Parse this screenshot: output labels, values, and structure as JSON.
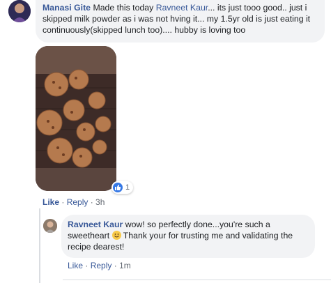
{
  "comment": {
    "author": "Manasi Gite",
    "text_before_mention": "Made this today",
    "mention": "Ravneet Kaur",
    "text_after_mention": "... its just tooo good.. just i skipped milk powder as i was not hving it... my 1.5yr old is just eating it continuously(skipped lunch too).... hubby is loving too",
    "reaction_count": "1",
    "actions": {
      "like": "Like",
      "reply": "Reply",
      "sep": " · ",
      "time": "3h"
    }
  },
  "reply": {
    "author": "Ravneet Kaur",
    "text_before_emoji": "wow! so perfectly done...you're such a sweetheart",
    "text_after_emoji": "Thank your for trusting me and validating the recipe dearest!",
    "actions": {
      "like": "Like",
      "reply": "Reply",
      "sep": " · ",
      "time": "1m"
    }
  },
  "colors": {
    "link": "#385898",
    "bubble": "#f2f3f5",
    "meta": "#606770",
    "like_blue": "#3578e5"
  },
  "icons": [
    "like-icon",
    "smile-emoji-icon"
  ]
}
